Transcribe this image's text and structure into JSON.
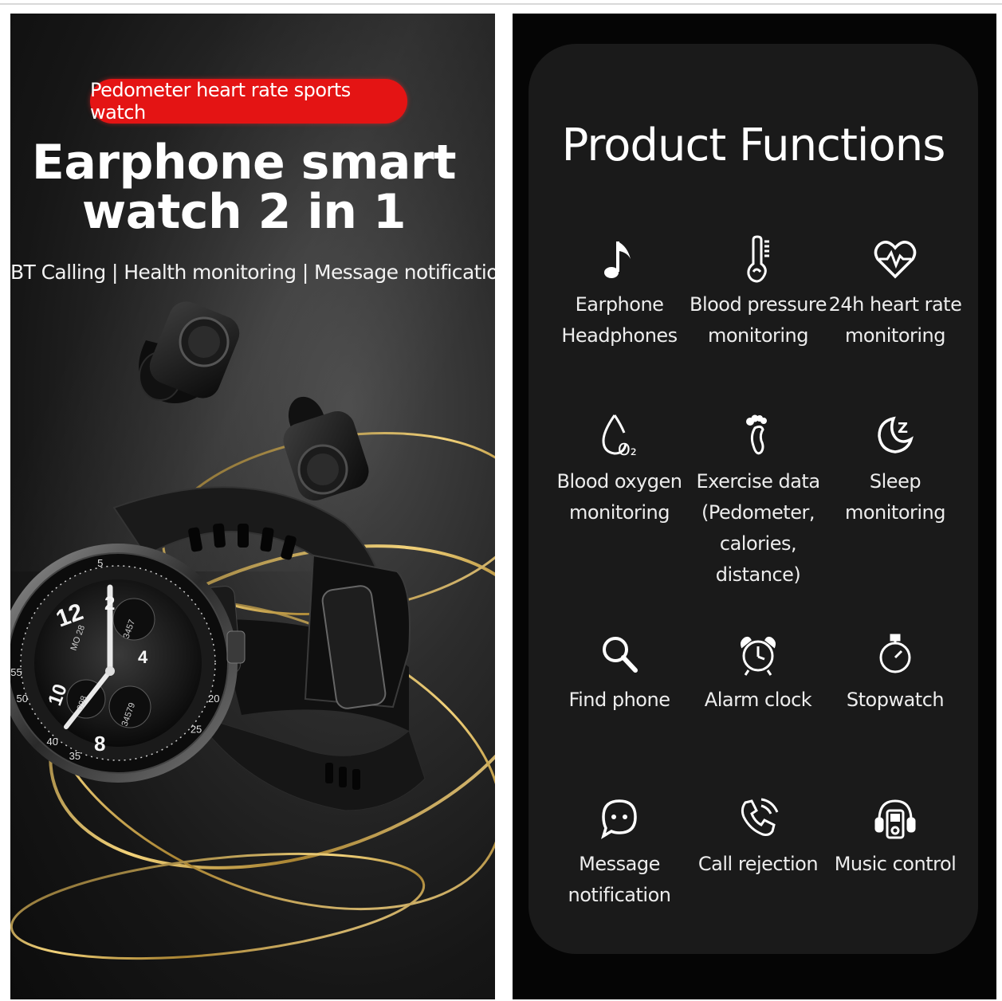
{
  "left": {
    "badge": "Pedometer heart rate sports watch",
    "headline_line1": "Earphone smart",
    "headline_line2": "watch 2 in 1",
    "features": "BT Calling | Health monitoring | Message notification",
    "watch_face": {
      "n12": "12",
      "n2": "2",
      "n4": "4",
      "n8": "8",
      "n10": "10",
      "date": "MO 28",
      "steps": "3457",
      "cal": "098",
      "dist": "34579",
      "bezel": [
        "5",
        "20",
        "25",
        "40",
        "35",
        "50",
        "55"
      ]
    }
  },
  "right": {
    "title": "Product Functions",
    "functions": [
      {
        "label1": "Earphone",
        "label2": "Headphones",
        "label3": "",
        "icon": "music-note-icon"
      },
      {
        "label1": "Blood pressure",
        "label2": "monitoring",
        "label3": "",
        "icon": "thermometer-icon"
      },
      {
        "label1": "24h heart rate",
        "label2": "monitoring",
        "label3": "",
        "icon": "heart-pulse-icon"
      },
      {
        "label1": "Blood oxygen",
        "label2": "monitoring",
        "label3": "",
        "icon": "oxygen-drop-icon"
      },
      {
        "label1": "Exercise data",
        "label2": "(Pedometer,",
        "label3": "calories, distance)",
        "icon": "footprint-icon"
      },
      {
        "label1": "Sleep",
        "label2": "monitoring",
        "label3": "",
        "icon": "moon-icon"
      },
      {
        "label1": "Find phone",
        "label2": "",
        "label3": "",
        "icon": "magnifier-icon"
      },
      {
        "label1": "Alarm clock",
        "label2": "",
        "label3": "",
        "icon": "alarm-clock-icon"
      },
      {
        "label1": "Stopwatch",
        "label2": "",
        "label3": "",
        "icon": "stopwatch-icon"
      },
      {
        "label1": "Message",
        "label2": "notification",
        "label3": "",
        "icon": "chat-bubble-icon"
      },
      {
        "label1": "Call rejection",
        "label2": "",
        "label3": "",
        "icon": "phone-call-icon"
      },
      {
        "label1": "Music control",
        "label2": "",
        "label3": "",
        "icon": "music-player-icon"
      }
    ],
    "oxygen_symbol": "O₂",
    "sleep_symbol": "Z"
  }
}
